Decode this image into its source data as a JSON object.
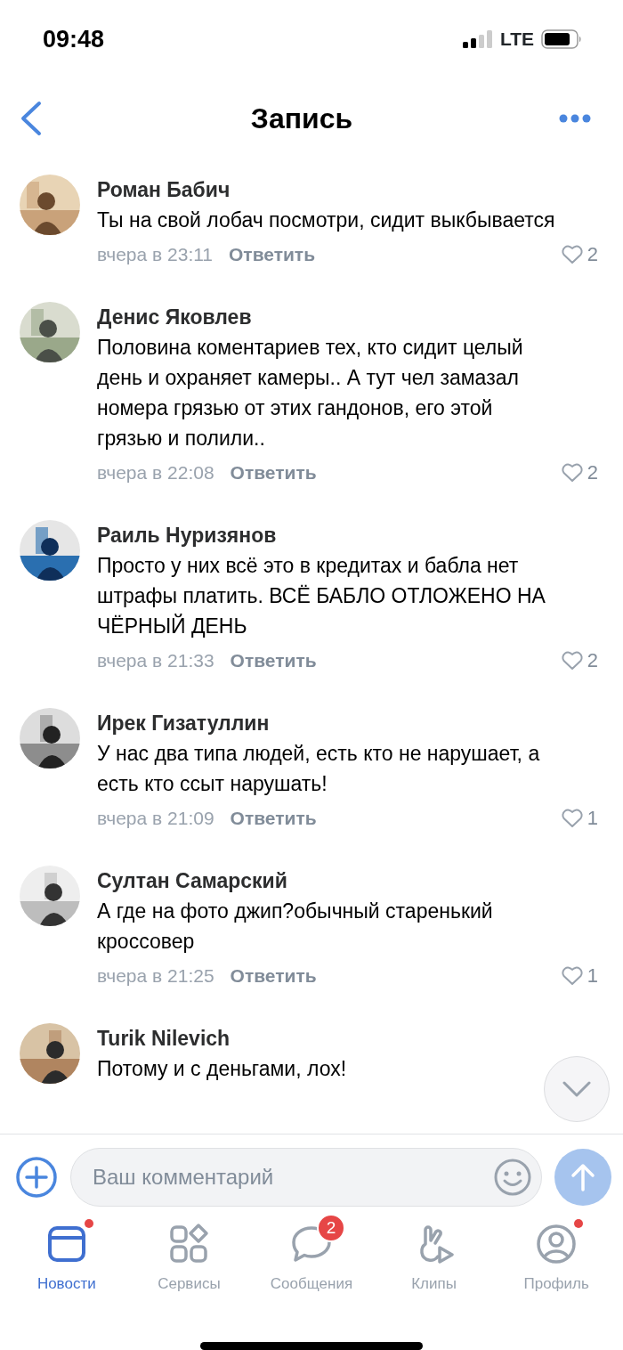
{
  "status_bar": {
    "time": "09:48",
    "network": "LTE"
  },
  "header": {
    "title": "Запись"
  },
  "comments": [
    {
      "author": "Роман Бабич",
      "text": "Ты на свой лобач посмотри, сидит выкбывается",
      "time": "вчера в 23:11",
      "reply": "Ответить",
      "likes": "2"
    },
    {
      "author": "Денис Яковлев",
      "text": "Половина коментариев тех, кто сидит целый день и охраняет камеры.. А тут чел замазал номера грязью от этих гандонов, его этой грязью и полили..",
      "time": "вчера в 22:08",
      "reply": "Ответить",
      "likes": "2"
    },
    {
      "author": "Раиль Нуризянов",
      "text": "Просто у них всё это в кредитах и бабла нет штрафы платить. ВСЁ БАБЛО ОТЛОЖЕНО НА ЧЁРНЫЙ ДЕНЬ",
      "time": "вчера в 21:33",
      "reply": "Ответить",
      "likes": "2"
    },
    {
      "author": "Ирек Гизатуллин",
      "text": "У нас два типа людей, есть кто не нарушает, а есть кто ссыт нарушать!",
      "time": "вчера в 21:09",
      "reply": "Ответить",
      "likes": "1"
    },
    {
      "author": "Султан Самарский",
      "text": "А где на фото джип?обычный старенький кроссовер",
      "time": "вчера в 21:25",
      "reply": "Ответить",
      "likes": "1"
    },
    {
      "author": "Turik Nilevich",
      "text": "Потому и с деньгами, лох!"
    }
  ],
  "comment_input": {
    "placeholder": "Ваш комментарий"
  },
  "tabs": [
    {
      "label": "Новости",
      "kind": "news",
      "selected": true,
      "dot": true
    },
    {
      "label": "Сервисы",
      "kind": "services",
      "selected": false,
      "dot": false
    },
    {
      "label": "Сообщения",
      "kind": "messages",
      "selected": false,
      "dot": false,
      "badge": "2"
    },
    {
      "label": "Клипы",
      "kind": "clips",
      "selected": false,
      "dot": false
    },
    {
      "label": "Профиль",
      "kind": "profile",
      "selected": false,
      "dot": true
    }
  ]
}
